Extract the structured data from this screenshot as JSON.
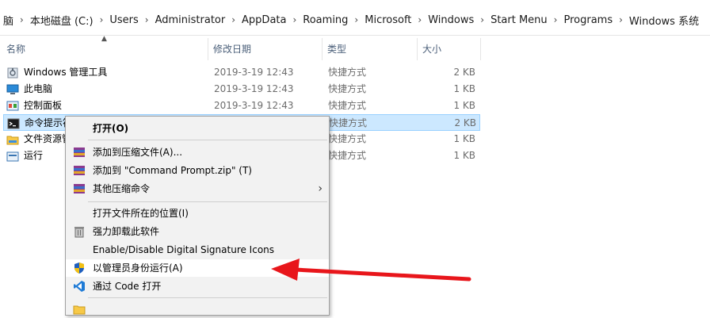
{
  "breadcrumb": [
    "脑",
    "本地磁盘 (C:)",
    "Users",
    "Administrator",
    "AppData",
    "Roaming",
    "Microsoft",
    "Windows",
    "Start Menu",
    "Programs",
    "Windows 系统"
  ],
  "columns": {
    "name": "名称",
    "date": "修改日期",
    "type": "类型",
    "size": "大小"
  },
  "files": [
    {
      "name": "Windows 管理工具",
      "date": "2019-3-19 12:43",
      "type": "快捷方式",
      "size": "2 KB",
      "icon": "admin-tools-icon"
    },
    {
      "name": "此电脑",
      "date": "2019-3-19 12:43",
      "type": "快捷方式",
      "size": "1 KB",
      "icon": "computer-icon"
    },
    {
      "name": "控制面板",
      "date": "2019-3-19 12:43",
      "type": "快捷方式",
      "size": "1 KB",
      "icon": "control-panel-icon"
    },
    {
      "name": "命令提示符",
      "date": "",
      "type": "快捷方式",
      "size": "2 KB",
      "icon": "cmd-icon",
      "selected": true
    },
    {
      "name": "文件资源管理器",
      "date": "",
      "type": "快捷方式",
      "size": "1 KB",
      "icon": "folder-icon"
    },
    {
      "name": "运行",
      "date": "",
      "type": "快捷方式",
      "size": "1 KB",
      "icon": "run-icon"
    }
  ],
  "context_menu": {
    "open": "打开(O)",
    "add_archive": "添加到压缩文件(A)...",
    "add_zip": "添加到 \"Command Prompt.zip\" (T)",
    "other_compress": "其他压缩命令",
    "open_location": "打开文件所在的位置(I)",
    "force_uninstall": "强力卸载此软件",
    "signature": "Enable/Disable Digital Signature Icons",
    "run_as_admin": "以管理员身份运行(A)",
    "open_code": "通过 Code 打开"
  },
  "colors": {
    "selection": "#cce8ff",
    "arrow": "#e8161b",
    "header_text": "#4c607a"
  }
}
